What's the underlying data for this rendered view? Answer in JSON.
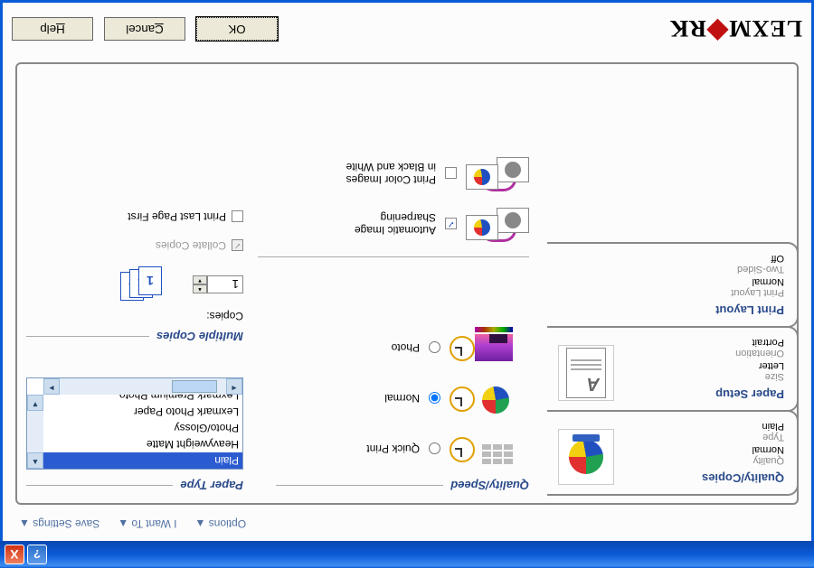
{
  "titlebar": {
    "help": "?",
    "close": "X"
  },
  "menus": {
    "options": "Options",
    "iwantto": "I Want To",
    "save": "Save Settings"
  },
  "tabs": {
    "quality": {
      "title": "Quality/Copies",
      "l1": "Quality",
      "v1": "Normal",
      "l2": "Type",
      "v2": "Plain"
    },
    "paper": {
      "title": "Paper Setup",
      "l1": "Size",
      "v1": "Letter",
      "l2": "Orientation",
      "v2": "Portrait"
    },
    "layout": {
      "title": "Print Layout",
      "l1": "Print Layout",
      "v1": "Normal",
      "l2": "Two-Sided",
      "v2": "Off"
    }
  },
  "quality_speed": {
    "title": "Quality/Speed",
    "quick": "Quick Print",
    "normal": "Normal",
    "photo": "Photo"
  },
  "image_opts": {
    "sharpen1": "Automatic Image",
    "sharpen2": "Sharpening",
    "bw1": "Print Color Images",
    "bw2": "in Black and White"
  },
  "paper_type": {
    "title": "Paper Type",
    "items": [
      "Plain",
      "Heavyweight Matte",
      "Photo/Glossy",
      "Lexmark Photo Paper",
      "Lexmark Premium Photo"
    ]
  },
  "copies": {
    "title": "Multiple Copies",
    "label": "Copies:",
    "value": "1",
    "collate": "Collate Copies",
    "last_first": "Print Last Page First"
  },
  "buttons": {
    "ok": "OK",
    "cancel": "Cancel",
    "help": "Help"
  },
  "logo": {
    "a": "LEXM",
    "b": "RK"
  }
}
